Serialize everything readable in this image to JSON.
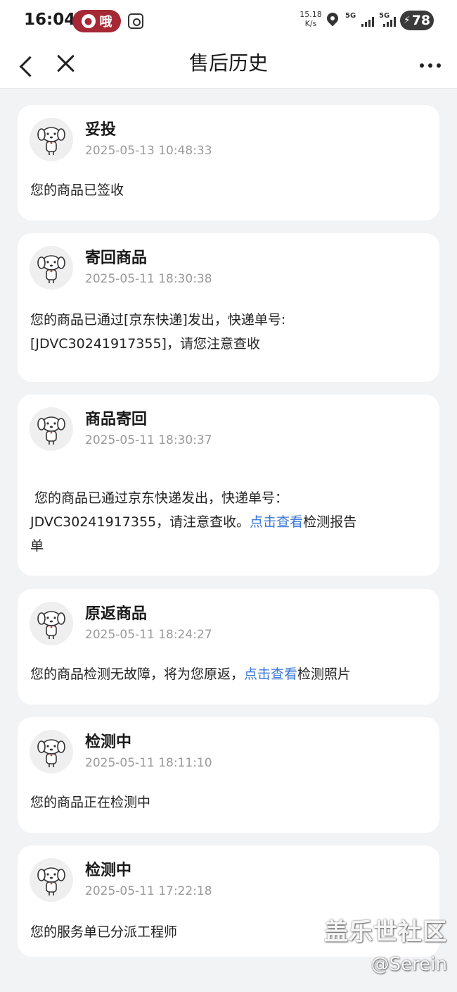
{
  "status_bar": {
    "time": "16:04",
    "pill_text": "哦",
    "speed_value": "15.18",
    "speed_unit": "K/s",
    "net1": "5G",
    "net2": "5G",
    "battery": "78"
  },
  "nav": {
    "title": "售后历史"
  },
  "records": [
    {
      "title": "妥投",
      "time": "2025-05-13 10:48:33",
      "message": "您的商品已签收"
    },
    {
      "title": "寄回商品",
      "time": "2025-05-11 18:30:38",
      "message_line1": "您的商品已通过[京东快递]发出，快递单号:",
      "message_line2": "[JDVC30241917355]，请您注意查收"
    },
    {
      "title": "商品寄回",
      "time": "2025-05-11 18:30:37",
      "message_line1": " 您的商品已通过京东快递发出，快递单号：",
      "message_line2_before": "JDVC30241917355，请注意查收。",
      "message_line2_link": "点击查看",
      "message_line2_after": "检测报告",
      "message_line3": "单"
    },
    {
      "title": "原返商品",
      "time": "2025-05-11 18:24:27",
      "message_before": "您的商品检测无故障，将为您原返，",
      "message_link": "点击查看",
      "message_after": "检测照片"
    },
    {
      "title": "检测中",
      "time": "2025-05-11 18:11:10",
      "message": "您的商品正在检测中"
    },
    {
      "title": "检测中",
      "time": "2025-05-11 17:22:18",
      "message": "您的服务单已分派工程师"
    }
  ],
  "watermark": {
    "line1": "盖乐世社区",
    "line2": "@Serein"
  },
  "colors": {
    "background": "#f2f3f5",
    "card": "#ffffff",
    "link": "#3a78d8",
    "time_gray": "#9a9a9a",
    "pill_red": "#a52834"
  }
}
